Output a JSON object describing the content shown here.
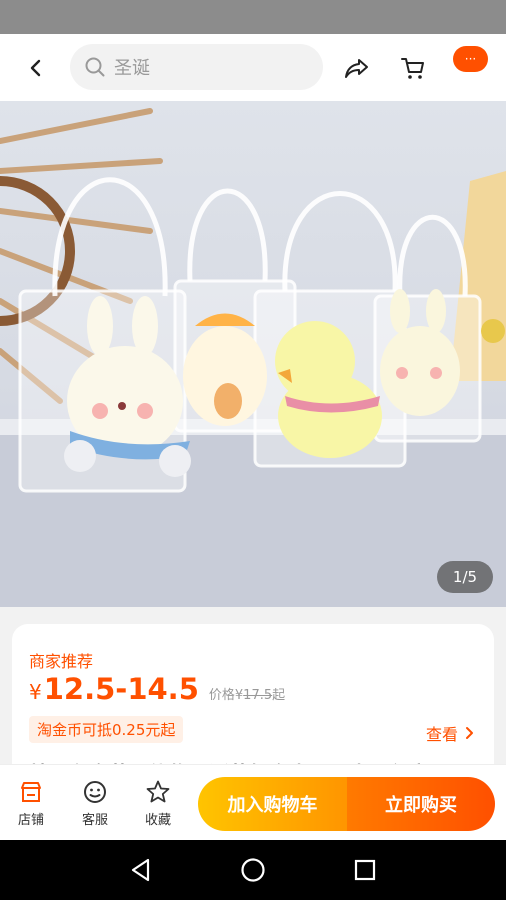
{
  "header": {
    "search_placeholder": "圣诞",
    "more_label": "···",
    "icons": [
      "back-icon",
      "search-icon",
      "share-icon",
      "cart-icon",
      "more-icon"
    ]
  },
  "gallery": {
    "counter": "1/5"
  },
  "product": {
    "recommend_label": "商家推荐",
    "currency": "¥",
    "price_range": "12.5-14.5",
    "orig_label": "价格",
    "orig_currency": "¥",
    "orig_price": "17.5",
    "orig_suffix": "起",
    "coin_text": "淘金币可抵0.25元起",
    "view_label": "查看",
    "title_peek": "特别有文艺小礼物圣诞节灯夜生日可生日创意"
  },
  "toolbar": {
    "shop_label": "店铺",
    "service_label": "客服",
    "fav_label": "收藏",
    "add_cart_label": "加入购物车",
    "buy_label": "立即购买"
  },
  "colors": {
    "accent": "#ff5000",
    "cart_gradient": [
      "#ffc400",
      "#ff9500"
    ],
    "buy_gradient": [
      "#ff7a00",
      "#ff5000"
    ]
  }
}
